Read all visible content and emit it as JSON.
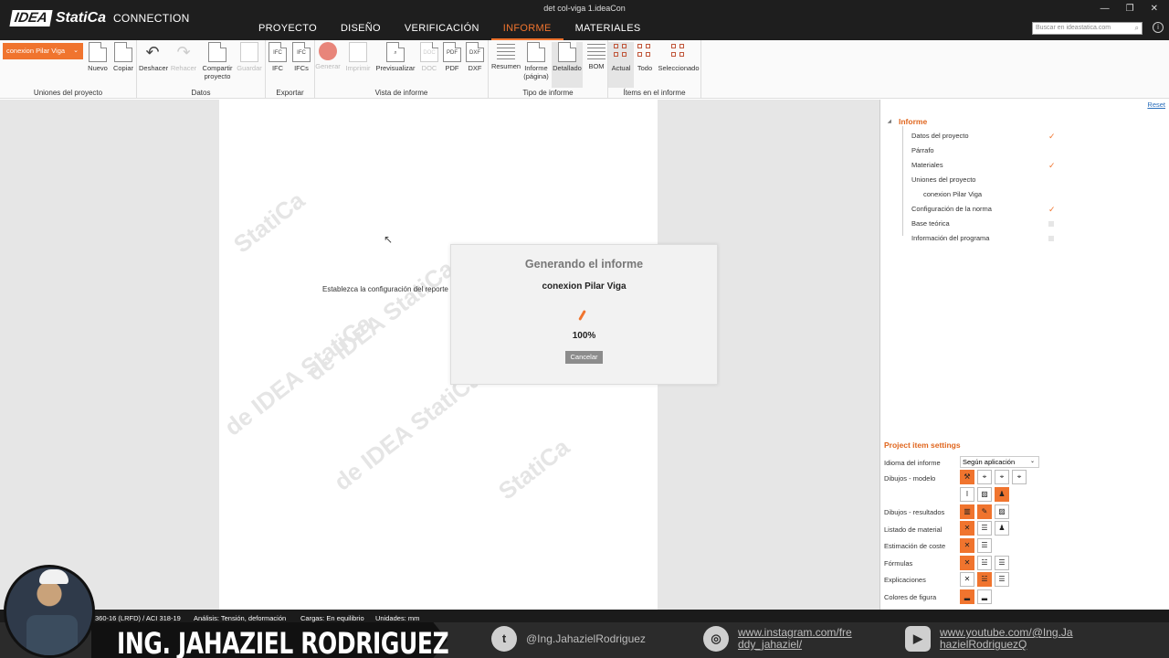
{
  "app": {
    "logo_idea": "IDEA",
    "logo_statica": "StatiCa",
    "product": "CONNECTION",
    "doc_title": "det col-viga 1.ideaCon",
    "window_controls": [
      "—",
      "❐",
      "✕"
    ]
  },
  "menu": [
    "PROYECTO",
    "DISEÑO",
    "VERIFICACIÓN",
    "INFORME",
    "MATERIALES"
  ],
  "menu_active": "INFORME",
  "search": {
    "placeholder": "Buscar en ideastatica.com"
  },
  "ribbon": {
    "connection_select": "conexion Pilar Viga",
    "groups": {
      "uniones": "Uniones del proyecto",
      "datos": "Datos",
      "exportar": "Exportar",
      "vista": "Vista de informe",
      "tipo": "Tipo de informe",
      "items": "Ítems en el informe"
    },
    "buttons": {
      "nuevo": "Nuevo",
      "copiar": "Copiar",
      "deshacer": "Deshacer",
      "rehacer": "Rehacer",
      "compartir": "Compartir proyecto",
      "guardar": "Guardar",
      "ifc": "IFC",
      "ifcs": "IFCs",
      "generar": "Generar",
      "imprimir": "Imprimir",
      "previsualizar": "Previsualizar",
      "doc": "DOC",
      "pdf": "PDF",
      "dxf": "DXF",
      "resumen": "Resumen",
      "informe_pagina": "Informe (página)",
      "detallado": "Detallado",
      "bom": "BOM",
      "actual": "Actual",
      "todo": "Todo",
      "seleccionado": "Seleccionado"
    }
  },
  "report_page": {
    "hint": "Establezca la configuración del reporte",
    "watermark": [
      "StatiCa",
      "de IDEA StatiCa",
      "de IDEA StatiCa",
      "de IDEA StatiCa",
      "StatiCa"
    ]
  },
  "modal": {
    "title": "Generando el informe",
    "subtitle": "conexion Pilar Viga",
    "progress_pct": "100%",
    "progress_fraction": 1.0,
    "cancel_label": "Cancelar"
  },
  "right_panel": {
    "reset": "Reset",
    "tree_root": "Informe",
    "tree_items": [
      {
        "label": "Datos del proyecto",
        "checked": true
      },
      {
        "label": "Párrafo",
        "checked": null
      },
      {
        "label": "Materiales",
        "checked": true
      },
      {
        "label": "Uniones del proyecto",
        "checked": null
      },
      {
        "label": "conexion Pilar Viga",
        "checked": null
      },
      {
        "label": "Configuración de la norma",
        "checked": true
      },
      {
        "label": "Base teórica",
        "checked": false
      },
      {
        "label": "Información del programa",
        "checked": false
      }
    ],
    "settings_title": "Project item settings",
    "settings": {
      "idioma_label": "Idioma del informe",
      "idioma_value": "Según aplicación",
      "dibujos_modelo": "Dibujos - modelo",
      "dibujos_resultados": "Dibujos - resultados",
      "listado_material": "Listado de material",
      "estimacion_coste": "Estimación de coste",
      "formulas": "Fórmulas",
      "explicaciones": "Explicaciones",
      "colores_figura": "Colores de figura"
    }
  },
  "status": {
    "code": "360-16 (LRFD) / ACI 318-19",
    "analysis": "Análisis: Tensión, deformación",
    "loads": "Cargas: En equilibrio",
    "units": "Unidades: mm"
  },
  "banner": {
    "name": "ING. JAHAZIEL RODRIGUEZ",
    "twitter": "@Ing.JahazielRodriguez",
    "instagram_1": "www.instagram.com/fre",
    "instagram_2": "ddy_jahaziel/",
    "youtube_1": "www.youtube.com/@Ing.Ja",
    "youtube_2": "hazielRodriguezQ"
  },
  "colors": {
    "accent": "#f0742e",
    "titlebar": "#1e1e1e"
  }
}
